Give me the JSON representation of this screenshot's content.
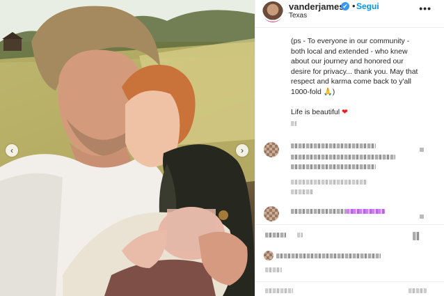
{
  "post": {
    "username": "vanderjames",
    "verified_mark": "✔",
    "separator": "•",
    "follow_label": "Segui",
    "location": "Texas",
    "more_label": "•••"
  },
  "caption": {
    "lines": [
      "(ps - To everyone in our community -",
      "both local and extended - who knew",
      "about our journey and honored our",
      "desire for privacy... thank you. May that",
      "respect and karma come back to y'all",
      "1000-fold 🙏)"
    ],
    "closing": "Life is beautiful",
    "closing_emoji": "❤"
  },
  "media": {
    "prev_label": "‹",
    "next_label": "›"
  },
  "icons": {
    "avatar": "profile-avatar-icon",
    "verified": "verified-badge-icon",
    "more": "more-options-icon",
    "carousel_prev": "chevron-left-icon",
    "carousel_next": "chevron-right-icon"
  },
  "colors": {
    "follow_blue": "#0095f6",
    "verified_blue": "#3897f0",
    "heart_red": "#ed1c24",
    "text": "#262626"
  }
}
